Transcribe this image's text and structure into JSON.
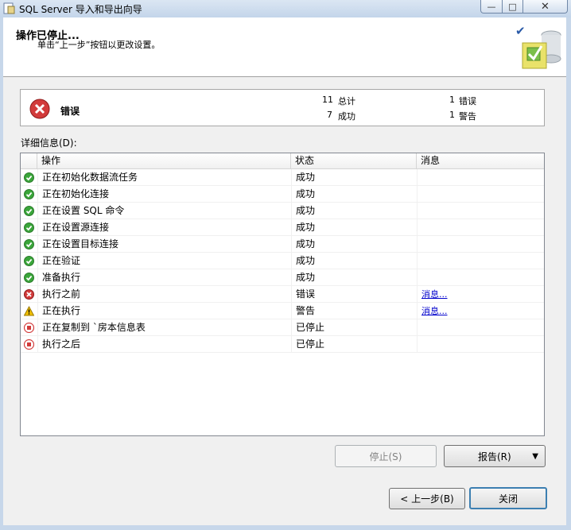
{
  "window": {
    "title": "SQL Server 导入和导出向导",
    "close_glyph": "✕",
    "min_glyph": "—",
    "max_glyph": "□"
  },
  "header": {
    "title": "操作已停止...",
    "subtitle": "单击“上一步”按钮以更改设置。"
  },
  "summary": {
    "status_label": "错误",
    "total_count": "11",
    "total_label": "总计",
    "success_count": "7",
    "success_label": "成功",
    "error_count": "1",
    "error_label": "错误",
    "warning_count": "1",
    "warning_label": "警告"
  },
  "details_label": "详细信息(D):",
  "table": {
    "columns": [
      "操作",
      "状态",
      "消息"
    ],
    "rows": [
      {
        "icon": "success",
        "action": "正在初始化数据流任务",
        "status": "成功",
        "message": ""
      },
      {
        "icon": "success",
        "action": "正在初始化连接",
        "status": "成功",
        "message": ""
      },
      {
        "icon": "success",
        "action": "正在设置 SQL 命令",
        "status": "成功",
        "message": ""
      },
      {
        "icon": "success",
        "action": "正在设置源连接",
        "status": "成功",
        "message": ""
      },
      {
        "icon": "success",
        "action": "正在设置目标连接",
        "status": "成功",
        "message": ""
      },
      {
        "icon": "success",
        "action": "正在验证",
        "status": "成功",
        "message": ""
      },
      {
        "icon": "success",
        "action": "准备执行",
        "status": "成功",
        "message": ""
      },
      {
        "icon": "error",
        "action": "执行之前",
        "status": "错误",
        "message": "消息..."
      },
      {
        "icon": "warning",
        "action": "正在执行",
        "status": "警告",
        "message": "消息..."
      },
      {
        "icon": "stopped",
        "action": "正在复制到 `房本信息表",
        "status": "已停止",
        "message": ""
      },
      {
        "icon": "stopped",
        "action": "执行之后",
        "status": "已停止",
        "message": ""
      }
    ]
  },
  "buttons": {
    "stop": "停止(S)",
    "report": "报告(R)",
    "back": "< 上一步(B)",
    "close": "关闭"
  },
  "colors": {
    "success": "#3aa53a",
    "error": "#d23b3b",
    "warning": "#f2c000",
    "link": "#0000cc"
  }
}
